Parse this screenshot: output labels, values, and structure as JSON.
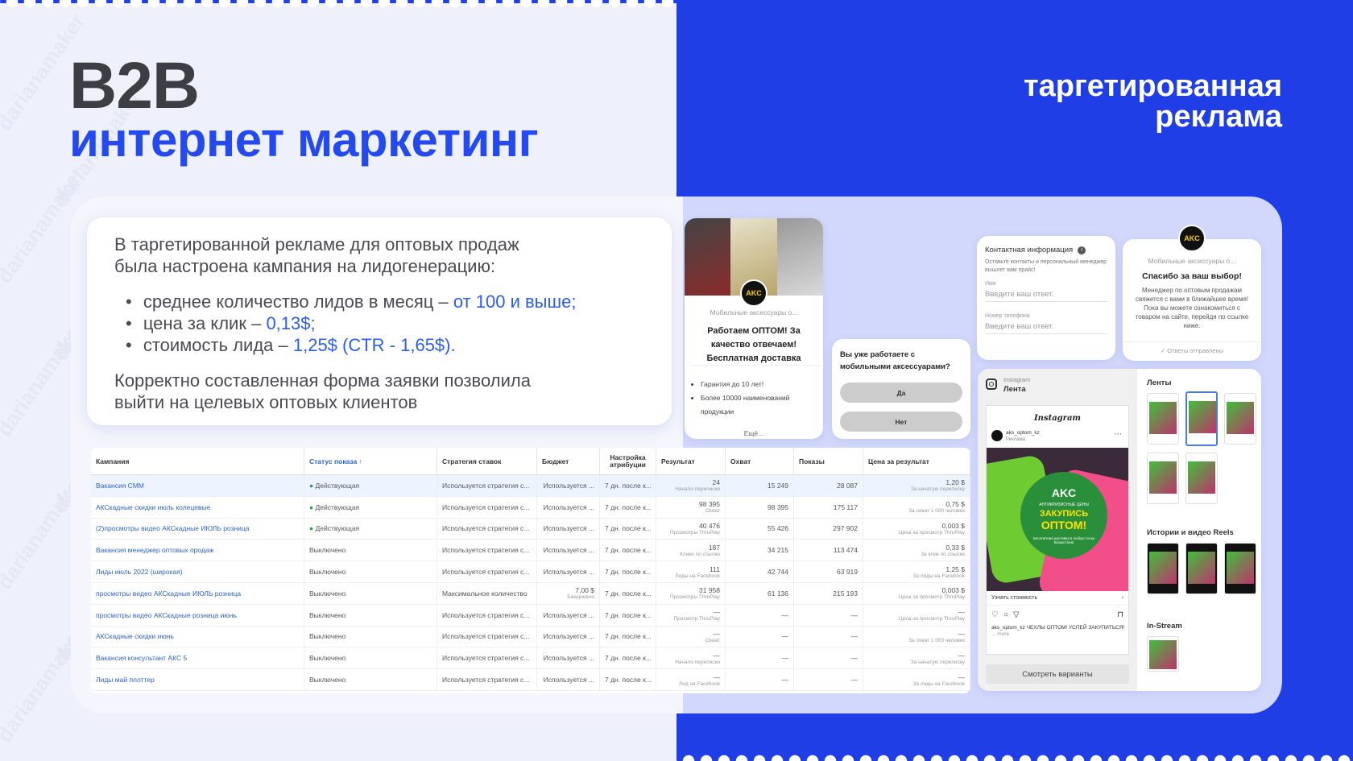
{
  "heading": {
    "title": "B2B",
    "subtitle": "интернет маркетинг",
    "right_line1": "таргетированная",
    "right_line2": "реклама"
  },
  "watermark": "darianamaker",
  "description": {
    "intro_line1": "В таргетированной рекламе для оптовых продаж",
    "intro_line2": "была настроена кампания на лидогенерацию:",
    "bullets": [
      {
        "text": "среднее количество лидов в месяц – ",
        "highlight": "от 100 и выше;"
      },
      {
        "text": "цена за клик – ",
        "highlight": "0,13$;"
      },
      {
        "text": "стоимость лида – ",
        "highlight": "1,25$ (CTR - 1,65$)."
      }
    ],
    "outro_line1": "Корректно составленная форма заявки позволила",
    "outro_line2": "выйти на целевых оптовых клиентов"
  },
  "table": {
    "headers": [
      "Кампания",
      "Статус показа ↑",
      "Стратегия ставок",
      "Бюджет",
      "Настройка атрибуции",
      "Результат",
      "Охват",
      "Показы",
      "Цена за результат"
    ],
    "rows": [
      {
        "name": "Вакансия СММ",
        "status": "Действующая",
        "active": true,
        "strategy": "Используется стратегия с...",
        "budget": "Используется ...",
        "budget_sub": "",
        "attr": "7 дн. после к...",
        "result": "24",
        "result_sub": "Начало переписки",
        "reach": "15 249",
        "impr": "28 087",
        "cost": "1,20 $",
        "cost_sub": "За начатую переписку"
      },
      {
        "name": "АКСкадные скидки июль колецевые",
        "status": "Действующая",
        "active": true,
        "strategy": "Используется стратегия с...",
        "budget": "Используется ...",
        "budget_sub": "",
        "attr": "7 дн. после к...",
        "result": "98 395",
        "result_sub": "Охват",
        "reach": "98 395",
        "impr": "175 117",
        "cost": "0,75 $",
        "cost_sub": "За охват 1 000 человек"
      },
      {
        "name": "(2)просмотры видео АКСкадные ИЮЛЬ розница",
        "status": "Действующая",
        "active": true,
        "strategy": "Используется стратегия с...",
        "budget": "Используется ...",
        "budget_sub": "",
        "attr": "7 дн. после к...",
        "result": "40 476",
        "result_sub": "Просмотры ThruPlay",
        "reach": "55 426",
        "impr": "297 902",
        "cost": "0,003 $",
        "cost_sub": "Цена за просмотр ThruPlay"
      },
      {
        "name": "Вакансия менеджер оптовых продаж",
        "status": "Выключено",
        "active": false,
        "strategy": "Используется стратегия с...",
        "budget": "Используется ...",
        "budget_sub": "",
        "attr": "7 дн. после к...",
        "result": "187",
        "result_sub": "Клики по ссылке",
        "reach": "34 215",
        "impr": "113 474",
        "cost": "0,33 $",
        "cost_sub": "За клик по ссылке"
      },
      {
        "name": "Лиды июль 2022 (широкая)",
        "status": "Выключено",
        "active": false,
        "strategy": "Используется стратегия с...",
        "budget": "Используется ...",
        "budget_sub": "",
        "attr": "7 дн. после к...",
        "result": "111",
        "result_sub": "Лиды на Facebook",
        "reach": "42 744",
        "impr": "63 919",
        "cost": "1,25 $",
        "cost_sub": "За лиды на Facebook"
      },
      {
        "name": "просмотры видео АКСкадные ИЮЛЬ розница",
        "status": "Выключено",
        "active": false,
        "strategy": "Максимальное количество",
        "budget": "7,00 $",
        "budget_sub": "Ежедневно",
        "attr": "7 дн. после к...",
        "result": "31 958",
        "result_sub": "Просмотры ThruPlay",
        "reach": "61 136",
        "impr": "215 193",
        "cost": "0,003 $",
        "cost_sub": "Цена за просмотр ThruPlay"
      },
      {
        "name": "просмотры видео АКСкадные розница июнь",
        "status": "Выключено",
        "active": false,
        "strategy": "Используется стратегия с...",
        "budget": "Используется ...",
        "budget_sub": "",
        "attr": "7 дн. после к...",
        "result": "—",
        "result_sub": "Просмотр ThruPlay",
        "reach": "—",
        "impr": "—",
        "cost": "—",
        "cost_sub": "Цена за просмотр ThruPlay"
      },
      {
        "name": "АКСкадные скидки июнь",
        "status": "Выключено",
        "active": false,
        "strategy": "Используется стратегия с...",
        "budget": "Используется ...",
        "budget_sub": "",
        "attr": "7 дн. после к...",
        "result": "—",
        "result_sub": "Охват",
        "reach": "—",
        "impr": "—",
        "cost": "—",
        "cost_sub": "За охват 1 000 человек"
      },
      {
        "name": "Вакансия консультант АКС 5",
        "status": "Выключено",
        "active": false,
        "strategy": "Используется стратегия с...",
        "budget": "Используется ...",
        "budget_sub": "",
        "attr": "7 дн. после к...",
        "result": "—",
        "result_sub": "Начало переписки",
        "reach": "—",
        "impr": "—",
        "cost": "—",
        "cost_sub": "За начатую переписку"
      },
      {
        "name": "Лиды май плоттер",
        "status": "Выключено",
        "active": false,
        "strategy": "Используется стратегия с...",
        "budget": "Используется ...",
        "budget_sub": "",
        "attr": "7 дн. после к...",
        "result": "—",
        "result_sub": "Лид на Facebook",
        "reach": "—",
        "impr": "—",
        "cost": "—",
        "cost_sub": "За лиды на Facebook"
      }
    ]
  },
  "ad_card": {
    "logo": "AKC",
    "page_name": "Мобильные аксессуары о...",
    "headline": "Работаем ОПТОМ! За качество отвечаем! Бесплатная доставка",
    "bullets": [
      "Гарантия до 10 лет!",
      "Более 10000 наименований продукции"
    ],
    "more": "Ещё..."
  },
  "question_card": {
    "question": "Вы уже работаете с мобильными аксессуарами?",
    "yes": "Да",
    "no": "Нет"
  },
  "contact_card": {
    "title": "Контактная информация",
    "subtitle": "Оставьте контакты и персональный менеджер вышлет вам прайс!",
    "name_label": "Имя",
    "name_placeholder": "Введите ваш ответ.",
    "phone_label": "Номер телефона",
    "phone_placeholder": "Введите ваш ответ."
  },
  "thanks_card": {
    "logo": "AKC",
    "page_name": "Мобильные аксессуары о...",
    "title": "Спасибо за ваш выбор!",
    "text": "Менеджер по оптовым продажам свяжется с вами в ближайшее время! Пока вы можете ознакомиться с товаром на сайте, перейдя по ссылке ниже.",
    "footer": "✓ Ответы отправлены"
  },
  "instagram_card": {
    "platform": "Instagram",
    "placement": "Лента",
    "brand": "Instagram",
    "account": "aks_optom_kz",
    "sponsored": "Реклама",
    "creative_logo": "AKC",
    "creative_tag": "АНТИКРИЗИСНЫЕ ЦЕНЫ",
    "creative_line1": "ЗАКУПИСЬ",
    "creative_line2": "ОПТОМ!",
    "creative_note": "Бесплатная доставка в любую точку Казахстана!",
    "cta": "Узнать стоимость",
    "caption": "aks_optom_kz ЧЕХЛЫ ОПТОМ! УСПЕЙ ЗАКУПИТЬСЯ!",
    "caption_more": "... more",
    "view_button": "Смотреть варианты"
  },
  "placements": {
    "feeds": "Ленты",
    "stories": "Истории и видео Reels",
    "instream": "In-Stream"
  },
  "colors": {
    "blue": "#1f3ee6",
    "accent": "#2d5cf0",
    "dark": "#3d3d44"
  }
}
